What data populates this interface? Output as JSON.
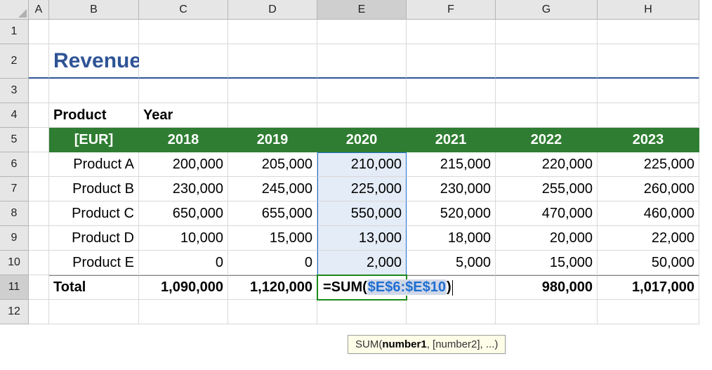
{
  "chart_data": {
    "type": "table",
    "title": "Revenue per year and product",
    "unit": "[EUR]",
    "categories": [
      "2018",
      "2019",
      "2020",
      "2021",
      "2022",
      "2023"
    ],
    "series": [
      {
        "name": "Product A",
        "values": [
          200000,
          205000,
          210000,
          215000,
          220000,
          225000
        ]
      },
      {
        "name": "Product B",
        "values": [
          230000,
          245000,
          225000,
          230000,
          255000,
          260000
        ]
      },
      {
        "name": "Product C",
        "values": [
          650000,
          655000,
          550000,
          520000,
          470000,
          460000
        ]
      },
      {
        "name": "Product D",
        "values": [
          10000,
          15000,
          13000,
          18000,
          20000,
          22000
        ]
      },
      {
        "name": "Product E",
        "values": [
          0,
          0,
          2000,
          5000,
          15000,
          50000
        ]
      }
    ],
    "totals": [
      1090000,
      1120000,
      null,
      980000,
      1017000
    ]
  },
  "columns": [
    "A",
    "B",
    "C",
    "D",
    "E",
    "F",
    "G",
    "H"
  ],
  "rows": [
    "1",
    "2",
    "3",
    "4",
    "5",
    "6",
    "7",
    "8",
    "9",
    "10",
    "11",
    "12"
  ],
  "title": "Revenue per year and product",
  "row4": {
    "product_label": "Product",
    "year_label": "Year"
  },
  "header": {
    "unit": "[EUR]",
    "y2018": "2018",
    "y2019": "2019",
    "y2020": "2020",
    "y2021": "2021",
    "y2022": "2022",
    "y2023": "2023"
  },
  "d": {
    "A": {
      "name": "Product A",
      "v": [
        "200,000",
        "205,000",
        "210,000",
        "215,000",
        "220,000",
        "225,000"
      ]
    },
    "B": {
      "name": "Product B",
      "v": [
        "230,000",
        "245,000",
        "225,000",
        "230,000",
        "255,000",
        "260,000"
      ]
    },
    "C": {
      "name": "Product C",
      "v": [
        "650,000",
        "655,000",
        "550,000",
        "520,000",
        "470,000",
        "460,000"
      ]
    },
    "D": {
      "name": "Product D",
      "v": [
        "10,000",
        "15,000",
        "13,000",
        "18,000",
        "20,000",
        "22,000"
      ]
    },
    "E": {
      "name": "Product E",
      "v": [
        "0",
        "0",
        "2,000",
        "5,000",
        "15,000",
        "50,000"
      ]
    }
  },
  "total": {
    "label": "Total",
    "v": [
      "1,090,000",
      "1,120,000",
      "",
      "980,000",
      "1,017,000"
    ]
  },
  "formula": {
    "prefix": "=SUM(",
    "ref": "$E$6:$E$10",
    "suffix": ")"
  },
  "tooltip": {
    "fn": "SUM(",
    "arg1": "number1",
    "rest": ", [number2], ...)"
  },
  "active_cell": "E11",
  "selected_range": "E6:E10"
}
